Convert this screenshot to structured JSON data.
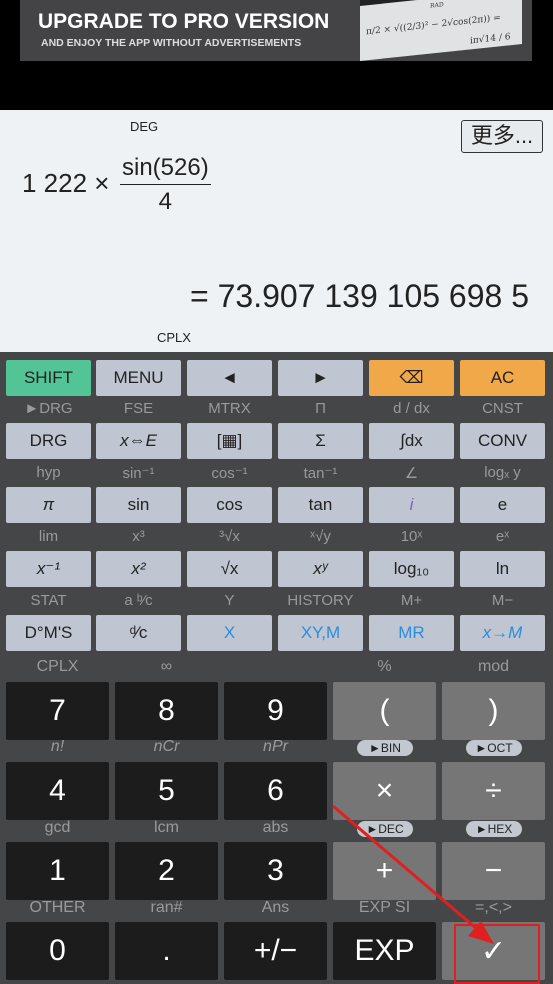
{
  "ad": {
    "title": "UPGRADE TO PRO VERSION",
    "subtitle": "AND ENJOY THE APP WITHOUT ADVERTISEMENTS",
    "image_text": {
      "mode": "RAD",
      "formula": "π/2 × √((2/3)² − 2√cos(2π)) =",
      "result": "iπ√14 / 6"
    }
  },
  "display": {
    "angle_mode": "DEG",
    "complex_mode": "CPLX",
    "more_button": "更多...",
    "expression": {
      "left": "1 222 ×",
      "numerator": "sin(526)",
      "denominator": "4"
    },
    "result": "= 73.907 139 105 698 5"
  },
  "colors": {
    "shift": "#52c496",
    "orange": "#f0a848",
    "light_key": "#bfc5d1",
    "number_key": "#1c1c1c",
    "operator_key": "#767676",
    "blue_text": "#2a8ee0",
    "purple_text": "#8a5cc0",
    "annotation": "#e02020"
  },
  "sci_rows": [
    {
      "labels": [],
      "keys": [
        {
          "t": "SHIFT",
          "c": "shift"
        },
        {
          "t": "MENU"
        },
        {
          "t": "◄"
        },
        {
          "t": "►"
        },
        {
          "t": "⌫",
          "c": "orange",
          "icon": "backspace-icon"
        },
        {
          "t": "AC",
          "c": "orange"
        }
      ]
    },
    {
      "labels": [
        "►DRG",
        "FSE",
        "MTRX",
        "Π",
        "d / dx",
        "CNST"
      ],
      "keys": [
        {
          "t": "DRG"
        },
        {
          "t": "x⇔E"
        },
        {
          "t": "[▦]",
          "icon": "matrix-icon"
        },
        {
          "t": "Σ"
        },
        {
          "t": "∫dx"
        },
        {
          "t": "CONV"
        }
      ]
    },
    {
      "labels": [
        "hyp",
        "sin⁻¹",
        "cos⁻¹",
        "tan⁻¹",
        "∠",
        "logₓ y"
      ],
      "keys": [
        {
          "t": "π"
        },
        {
          "t": "sin"
        },
        {
          "t": "cos"
        },
        {
          "t": "tan"
        },
        {
          "t": "i",
          "c": "purple"
        },
        {
          "t": "e"
        }
      ]
    },
    {
      "labels": [
        "lim",
        "x³",
        "³√x",
        "ˣ√y",
        "10ˣ",
        "eˣ"
      ],
      "keys": [
        {
          "t": "x⁻¹"
        },
        {
          "t": "x²"
        },
        {
          "t": "√x"
        },
        {
          "t": "xʸ"
        },
        {
          "t": "log₁₀"
        },
        {
          "t": "ln"
        }
      ]
    },
    {
      "labels": [
        "STAT",
        "a ᵇ⁄c",
        "Y",
        "HISTORY",
        "M+",
        "M−"
      ],
      "keys": [
        {
          "t": "D°M'S"
        },
        {
          "t": "ᵈ⁄c"
        },
        {
          "t": "X",
          "c": "blue"
        },
        {
          "t": "XY,M",
          "c": "blue"
        },
        {
          "t": "MR",
          "c": "blue"
        },
        {
          "t": "x→M",
          "c": "blue"
        }
      ]
    }
  ],
  "num_rows": [
    {
      "labels": [
        "CPLX",
        "∞",
        "",
        "%",
        "mod"
      ],
      "pills": [],
      "keys": [
        {
          "t": "7"
        },
        {
          "t": "8"
        },
        {
          "t": "9"
        },
        {
          "t": "(",
          "c": "op"
        },
        {
          "t": ")",
          "c": "op"
        }
      ]
    },
    {
      "labels": [
        "n!",
        "nCr",
        "nPr",
        "",
        ""
      ],
      "pills": [
        "",
        "",
        "",
        "►BIN",
        "►OCT"
      ],
      "keys": [
        {
          "t": "4"
        },
        {
          "t": "5"
        },
        {
          "t": "6"
        },
        {
          "t": "×",
          "c": "op"
        },
        {
          "t": "÷",
          "c": "op"
        }
      ]
    },
    {
      "labels": [
        "gcd",
        "lcm",
        "abs",
        "",
        ""
      ],
      "pills": [
        "",
        "",
        "",
        "►DEC",
        "►HEX"
      ],
      "keys": [
        {
          "t": "1"
        },
        {
          "t": "2"
        },
        {
          "t": "3"
        },
        {
          "t": "+",
          "c": "op"
        },
        {
          "t": "−",
          "c": "op"
        }
      ]
    },
    {
      "labels": [
        "OTHER",
        "ran#",
        "Ans",
        "EXP SI",
        "=,<,>"
      ],
      "pills": [],
      "keys": [
        {
          "t": "0"
        },
        {
          "t": "."
        },
        {
          "t": "+/−"
        },
        {
          "t": "EXP"
        },
        {
          "t": "✓",
          "c": "op",
          "icon": "checkmark-icon"
        }
      ]
    }
  ]
}
